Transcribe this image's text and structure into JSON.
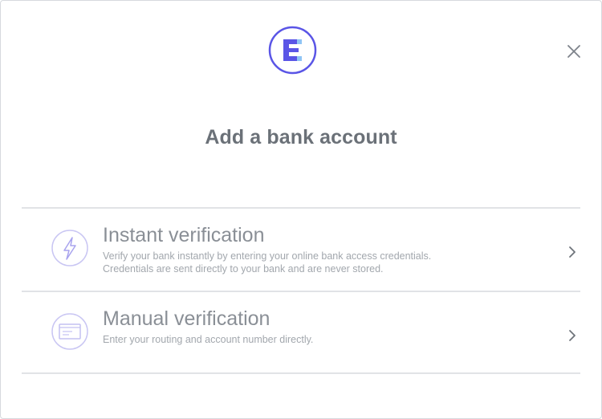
{
  "modal": {
    "title": "Add a bank account",
    "logo_icon": "evolve-logo-icon",
    "close_icon": "close-icon",
    "accent_color": "#5a55e6"
  },
  "options": [
    {
      "title": "Instant verification",
      "description_line1": "Verify your bank instantly by entering your online bank access credentials.",
      "description_line2": "Credentials are sent directly to your bank and are never stored.",
      "icon": "lightning-bolt-icon"
    },
    {
      "title": "Manual verification",
      "description_line1": "Enter your routing and account number directly.",
      "icon": "check-document-icon"
    }
  ]
}
